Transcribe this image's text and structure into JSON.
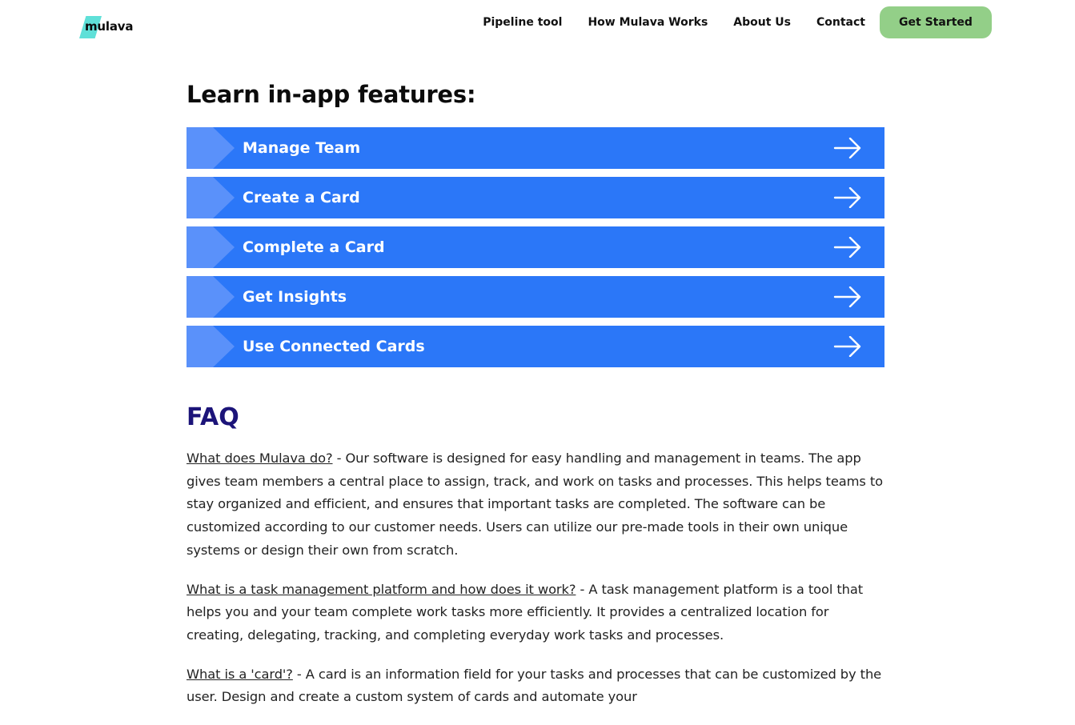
{
  "header": {
    "logo_text": "mulava",
    "nav": [
      "Pipeline tool",
      "How Mulava Works",
      "About Us",
      "Contact"
    ],
    "cta_label": "Get Started",
    "colors": {
      "cta_bg": "#93cf88",
      "logo_mark": "#5fe0d8"
    }
  },
  "features": {
    "title": "Learn in-app features:",
    "items": [
      {
        "label": "Manage Team",
        "icon": "arrow-right-icon"
      },
      {
        "label": "Create a Card",
        "icon": "arrow-right-icon"
      },
      {
        "label": "Complete a Card",
        "icon": "arrow-right-icon"
      },
      {
        "label": "Get Insights",
        "icon": "arrow-right-icon"
      },
      {
        "label": "Use Connected Cards",
        "icon": "arrow-right-icon"
      }
    ],
    "colors": {
      "bar": "#2b77f8",
      "chevron": "#5a91fa"
    }
  },
  "faq": {
    "title": "FAQ",
    "color": "#1c1479",
    "items": [
      {
        "question": "What does Mulava do?",
        "answer": " - Our software is designed for easy handling and management in teams. The app gives team members a central place to assign, track, and work on tasks and processes. This helps teams to stay organized and efficient, and ensures that important tasks are completed. The software can be customized according to our customer needs. Users can utilize our pre-made tools in their own unique systems or design their own from scratch."
      },
      {
        "question": "What is a task management platform and how does it work?",
        "answer": " - A task management platform is a tool that helps you and your team complete work tasks more efficiently. It provides a centralized location for creating, delegating, tracking, and completing everyday work tasks and processes."
      },
      {
        "question": "What is a 'card'?",
        "answer": " - A card is an information field for your tasks and processes that can be customized by the user. Design and create a custom system of cards and automate your"
      }
    ]
  }
}
